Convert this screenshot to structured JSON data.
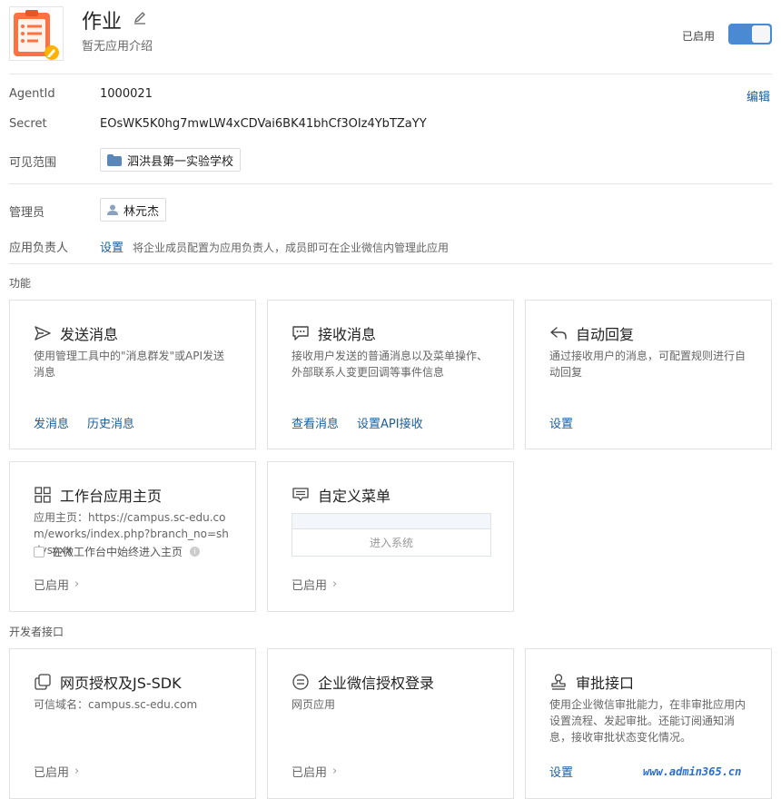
{
  "app": {
    "title": "作业",
    "description": "暂无应用介绍",
    "enabled_label": "已启用",
    "enabled": true,
    "accent_color": "#4a8ad2"
  },
  "info": {
    "edit_label": "编辑",
    "agentid_label": "AgentId",
    "agentid_value": "1000021",
    "secret_label": "Secret",
    "secret_value": "EOsWK5K0hg7mwLW4xCDVai6BK41bhCf3OIz4YbTZaYY",
    "scope_label": "可见范围",
    "scope_value": "泗洪县第一实验学校",
    "admin_label": "管理员",
    "admin_value": "林元杰",
    "owner_label": "应用负责人",
    "owner_link": "设置",
    "owner_hint": "将企业成员配置为应用负责人，成员即可在企业微信内管理此应用"
  },
  "features": {
    "section_title": "功能",
    "send": {
      "title": "发送消息",
      "desc": "使用管理工具中的\"消息群发\"或API发送消息",
      "action1": "发消息",
      "action2": "历史消息"
    },
    "receive": {
      "title": "接收消息",
      "desc": "接收用户发送的普通消息以及菜单操作、外部联系人变更回调等事件信息",
      "action1": "查看消息",
      "action2": "设置API接收"
    },
    "autoreply": {
      "title": "自动回复",
      "desc": "通过接收用户的消息，可配置规则进行自动回复",
      "action1": "设置"
    },
    "homepage": {
      "title": "工作台应用主页",
      "desc": "应用主页：https://campus.sc-edu.com/eworks/index.php?branch_no=shdysyxx",
      "checkbox_label": "在微工作台中始终进入主页",
      "status": "已启用"
    },
    "menu": {
      "title": "自定义菜单",
      "preview_text": "进入系统",
      "status": "已启用"
    }
  },
  "developer": {
    "section_title": "开发者接口",
    "web_auth": {
      "title": "网页授权及JS-SDK",
      "desc": "可信域名：campus.sc-edu.com",
      "status": "已启用"
    },
    "wework_login": {
      "title": "企业微信授权登录",
      "desc": "网页应用",
      "status": "已启用"
    },
    "approval": {
      "title": "审批接口",
      "desc": "使用企业微信审批能力，在非审批应用内设置流程、发起审批。还能订阅通知消息，接收审批状态变化情况。",
      "action1": "设置"
    }
  },
  "watermark": "www.admin365.cn"
}
